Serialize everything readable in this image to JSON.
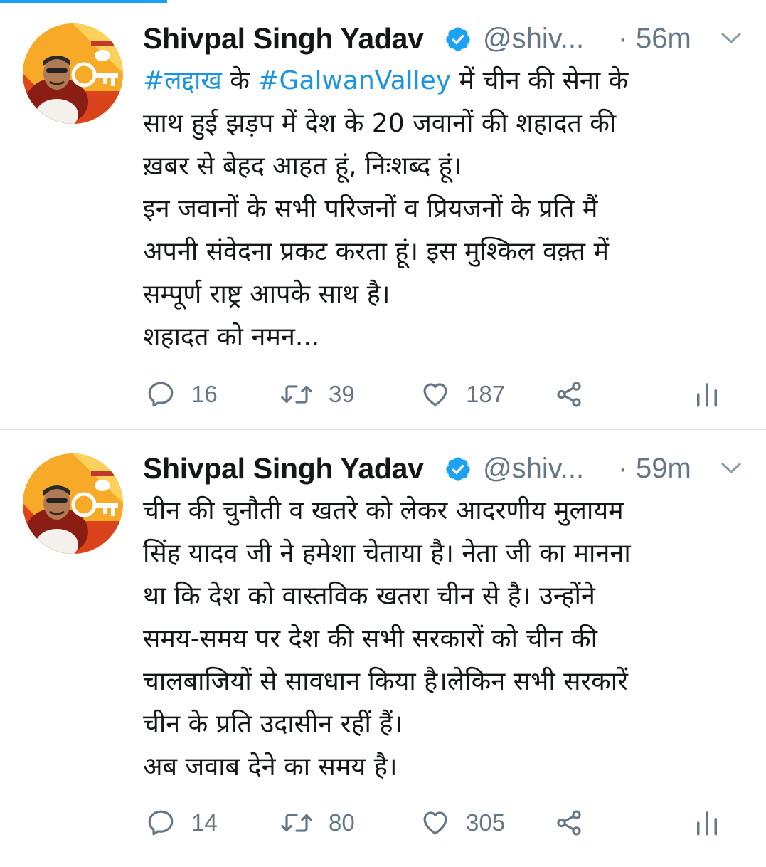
{
  "tweets": [
    {
      "author": "Shivpal Singh Yadav",
      "handle": "@shiv...",
      "dot": "·",
      "time": "56m",
      "lines": [
        [
          "#लद्दाख",
          " के ",
          "#GalwanValley",
          " में चीन की सेना के"
        ],
        "साथ हुई झड़प में देश के 20 जवानों की शहादत की",
        "ख़बर से बेहद आहत हूं, निःशब्द हूं।",
        "इन जवानों के सभी परिजनों व प्रियजनों के प्रति मैं",
        "अपनी संवेदना प्रकट करता हूं। इस मुश्किल वक़्त में",
        "सम्पूर्ण राष्ट्र आपके साथ है।",
        "शहादत को नमन..."
      ],
      "replies": "16",
      "retweets": "39",
      "likes": "187"
    },
    {
      "author": "Shivpal Singh Yadav",
      "handle": "@shiv...",
      "dot": "·",
      "time": "59m",
      "lines": [
        "चीन की चुनौती व खतरे को लेकर आदरणीय मुलायम",
        "सिंह यादव जी ने हमेशा चेताया है। नेता जी का मानना",
        "था कि देश को वास्तविक खतरा चीन से है। उन्होंने",
        "समय-समय पर देश की सभी सरकारों को चीन की",
        "चालबाजियों से सावधान किया है।लेकिन सभी सरकारें",
        "चीन के प्रति उदासीन रहीं हैं।",
        "अब जवाब देने का समय है।"
      ],
      "replies": "14",
      "retweets": "80",
      "likes": "305"
    }
  ],
  "icons": {
    "reply": "reply-icon",
    "retweet": "retweet-icon",
    "like": "heart-icon",
    "share": "share-icon",
    "stats": "analytics-icon",
    "verified": "verified-badge-icon",
    "caret": "chevron-down-icon"
  },
  "colors": {
    "accent": "#1da1f2",
    "hashtag": "#1b95e0",
    "secondary_text": "#657786",
    "primary_text": "#14171a"
  }
}
